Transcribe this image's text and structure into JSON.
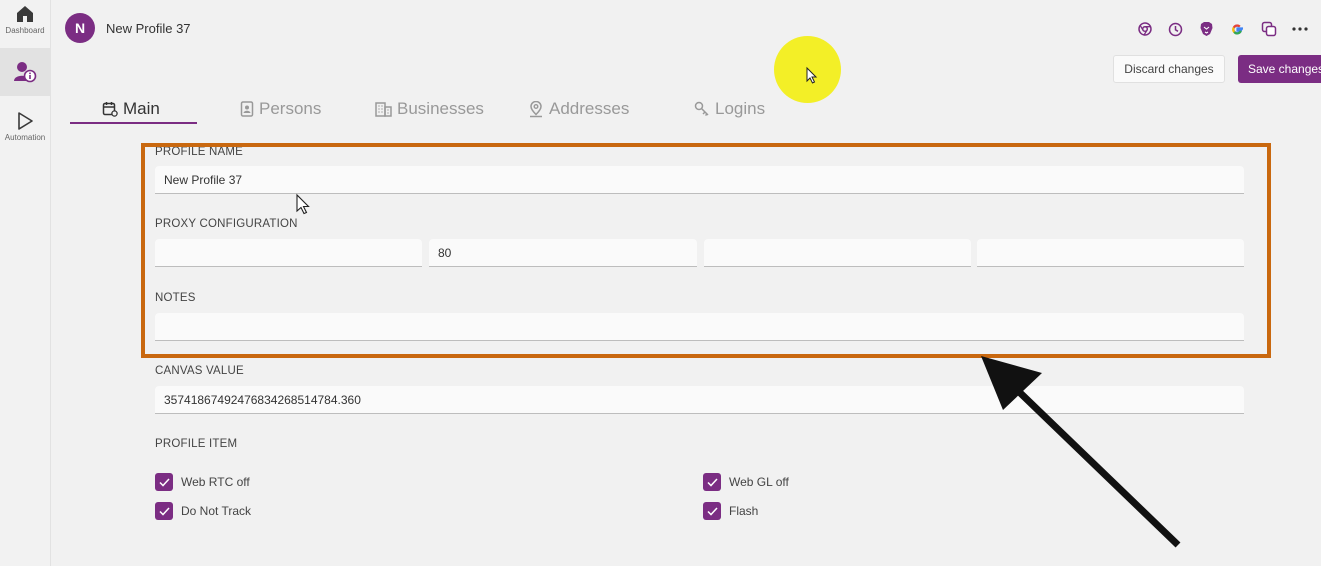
{
  "sidebar": {
    "items": [
      {
        "label": "Dashboard",
        "icon": "home-icon"
      },
      {
        "label": "",
        "icon": "profile-info-icon"
      },
      {
        "label": "Automation",
        "icon": "play-icon"
      }
    ]
  },
  "header": {
    "avatar_letter": "N",
    "profile_title": "New Profile 37",
    "icons": [
      "chrome-icon",
      "history-icon",
      "brave-icon",
      "google-icon",
      "copy-icon",
      "more-icon"
    ]
  },
  "actions": {
    "discard_label": "Discard changes",
    "save_label": "Save changes"
  },
  "tabs": [
    {
      "label": "Main",
      "icon": "calendar-settings-icon",
      "active": true
    },
    {
      "label": "Persons",
      "icon": "id-badge-icon",
      "active": false
    },
    {
      "label": "Businesses",
      "icon": "building-icon",
      "active": false
    },
    {
      "label": "Addresses",
      "icon": "map-pin-icon",
      "active": false
    },
    {
      "label": "Logins",
      "icon": "key-icon",
      "active": false
    }
  ],
  "form": {
    "profile_name": {
      "label": "PROFILE NAME",
      "value": "New Profile 37"
    },
    "proxy": {
      "label": "PROXY CONFIGURATION",
      "fields": [
        "",
        "80",
        "",
        ""
      ]
    },
    "notes": {
      "label": "NOTES",
      "value": ""
    },
    "canvas": {
      "label": "CANVAS VALUE",
      "value": "357418674924768342685147​84.360"
    },
    "profile_item": {
      "label": "PROFILE ITEM",
      "checkboxes": [
        {
          "label": "Web RTC off",
          "checked": true
        },
        {
          "label": "Web GL off",
          "checked": true
        },
        {
          "label": "Do Not Track",
          "checked": true
        },
        {
          "label": "Flash",
          "checked": true
        }
      ]
    }
  },
  "colors": {
    "accent": "#7b2d83",
    "highlight_border": "#c9680f",
    "cursor_highlight": "#f2ee1b"
  }
}
